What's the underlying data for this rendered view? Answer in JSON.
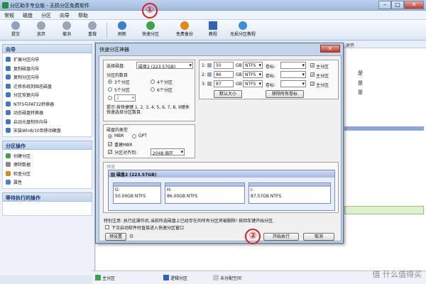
{
  "app": {
    "title": "分区助手专业版 - 无损分区免费软件"
  },
  "menu": [
    "常规",
    "磁盘",
    "分区",
    "向导",
    "帮助"
  ],
  "toolbar": {
    "buttons": [
      "提交",
      "放弃",
      "撤消",
      "重做",
      "刷新",
      "快速分区",
      "免费备份",
      "教程",
      "无损分区教程"
    ]
  },
  "annotations": {
    "one": "①",
    "two": "②"
  },
  "sidebar": {
    "wizard_title": "向导",
    "wizard_items": [
      "扩展分区向导",
      "复制磁盘向导",
      "复制分区向导",
      "迁移系统到固态磁盘",
      "分区恢复向导",
      "NTFS与FAT32转换器",
      "动态磁盘转换器",
      "启动光盘制作向导",
      "安装Win8/10到移动硬盘"
    ],
    "ops_title": "分区操作",
    "ops_items": [
      "创建分区",
      "擦除数据",
      "检查分区",
      "属性"
    ],
    "pending_title": "等待执行的操作"
  },
  "right_panel": {
    "header_cut": "对齐",
    "yes_values": [
      "是",
      "是",
      "是"
    ]
  },
  "legend": [
    "主分区",
    "逻辑分区",
    "未分配空间"
  ],
  "watermark": "值 什么值得买",
  "dialog": {
    "title": "快速分区神器",
    "close": "✕",
    "select_disk_label": "选择磁盘:",
    "select_disk_value": "磁盘2 (223.57GB)",
    "partition_count_label": "分区的数目",
    "radio_options": [
      "3个分区",
      "4个分区",
      "5个分区",
      "6个分区"
    ],
    "custom_count": "2",
    "hint": "提示:按快捷键 1, 2, 3, 4, 5, 6, 7, 8, 9键来快速选择分区数目.",
    "disk_type_label": "磁盘的类型",
    "mbr": "MBR",
    "gpt": "GPT",
    "rebuild_mbr": "重建MBR",
    "align_label": "分区对齐到:",
    "align_value": "2048 扇区",
    "partitions": [
      {
        "num": "1:",
        "size": "50",
        "unit": "GB",
        "fs": "NTFS",
        "vol_label": "卷标:",
        "primary": "主分区"
      },
      {
        "num": "2:",
        "size": "86",
        "unit": "GB",
        "fs": "NTFS",
        "vol_label": "卷标:",
        "primary": "主分区"
      },
      {
        "num": "3:",
        "size": "87",
        "unit": "GB",
        "fs": "NTFS",
        "vol_label": "卷标:",
        "primary": "主分区"
      }
    ],
    "default_size_btn": "默认大小",
    "clear_labels_btn": "移除所有卷标",
    "preview_label": "预览",
    "disk_bar_title": "磁盘2 (223.57GB)",
    "bars": [
      {
        "letter": "G:",
        "info": "50.00GB NTFS"
      },
      {
        "letter": "H:",
        "info": "86.00GB NTFS"
      },
      {
        "letter": "I:",
        "info": "87.57GB NTFS"
      }
    ],
    "warning": "特别注意: 执行此操作后,当前所选磁盘上已经存在的所有分区将被删除! 按回车键开始分区.",
    "next_time_checkbox": "下次启动软件时直接进入快速分区窗口",
    "preset_btn": "预设置",
    "start_btn": "开始执行",
    "cancel_btn": "取消"
  }
}
